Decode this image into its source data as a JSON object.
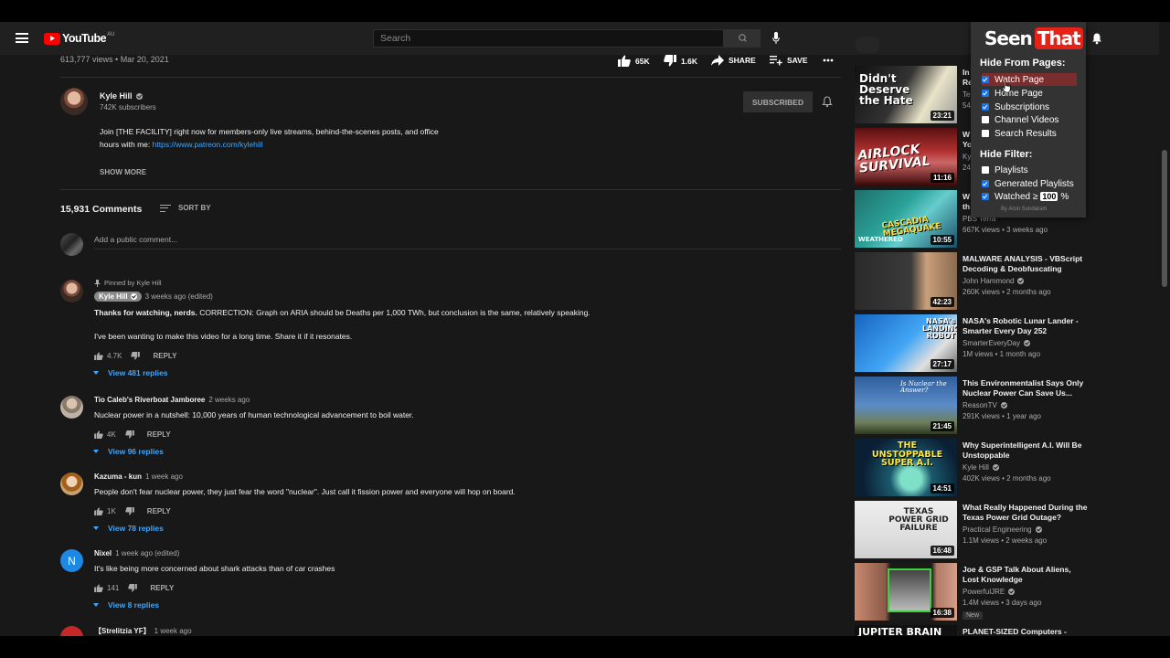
{
  "masthead": {
    "logo_text": "YouTube",
    "logo_region": "AU",
    "search_placeholder": "Search"
  },
  "video": {
    "views_date": "613,777 views • Mar 20, 2021",
    "likes": "65K",
    "dislikes": "1.6K",
    "share_label": "SHARE",
    "save_label": "SAVE"
  },
  "channel": {
    "name": "Kyle Hill",
    "subscribers": "742K subscribers",
    "subscribed_label": "SUBSCRIBED"
  },
  "description": {
    "line1": "Join [THE FACILITY] right now for members-only live streams, behind-the-scenes posts, and office",
    "line2_prefix": "hours with me: ",
    "link": "https://www.patreon.com/kylehill",
    "show_more": "SHOW MORE"
  },
  "comments": {
    "count_label": "15,931 Comments",
    "sort_label": "SORT BY",
    "add_placeholder": "Add a public comment...",
    "items": [
      {
        "pinned": "Pinned by Kyle Hill",
        "author": "Kyle Hill",
        "time": "3 weeks ago (edited)",
        "text_bold": "Thanks for watching, nerds.",
        "text": " CORRECTION: Graph on ARIA should be Deaths per 1,000 TWh, but conclusion is the same, relatively speaking.",
        "text2": "I've been wanting to make this video for a long time. Share it if it resonates.",
        "likes": "4.7K",
        "reply": "REPLY",
        "replies": "View 481 replies"
      },
      {
        "author": "Tio Caleb's Riverboat Jamboree",
        "time": "2 weeks ago",
        "text": "Nuclear power in a nutshell: 10,000 years of human technological advancement to boil water.",
        "likes": "4K",
        "reply": "REPLY",
        "replies": "View 96 replies"
      },
      {
        "author": "Kazuma - kun",
        "time": "1 week ago",
        "text": "People don't fear nuclear power, they just fear the word \"nuclear\". Just call it fission power and everyone will hop on board.",
        "likes": "1K",
        "reply": "REPLY",
        "replies": "View 78 replies"
      },
      {
        "author": "Nixel",
        "avatar_letter": "N",
        "time": "1 week ago (edited)",
        "text": "It's like being more concerned about shark attacks than of car crashes",
        "likes": "141",
        "reply": "REPLY",
        "replies": "View 8 replies"
      },
      {
        "author": "【Strelitzia YF】",
        "time": "1 week ago"
      }
    ]
  },
  "recommendations": [
    {
      "title": "In",
      "title2": "Re",
      "channel": "Te",
      "meta": "54",
      "duration": "23:21",
      "thumb_text": "Didn't Deserve the Hate"
    },
    {
      "title": "W",
      "title2": "Yo",
      "channel": "Ky",
      "meta": "24",
      "duration": "11:16",
      "thumb_text": "AIRLOCK SURVIVAL"
    },
    {
      "title": "W",
      "title2": "th",
      "channel": "PBS Terra",
      "meta": "667K views • 3 weeks ago",
      "duration": "10:55",
      "thumb_text": "CASCADIA MEGAQUAKE",
      "thumb_text2": "WEATHERED"
    },
    {
      "title": "MALWARE ANALYSIS - VBScript Decoding & Deobfuscating",
      "channel": "John Hammond",
      "meta": "260K views • 2 months ago",
      "duration": "42:23"
    },
    {
      "title": "NASA's Robotic Lunar Lander - Smarter Every Day 252",
      "channel": "SmarterEveryDay",
      "meta": "1M views • 1 month ago",
      "duration": "27:17",
      "thumb_text": "NASA's LANDING ROBOT"
    },
    {
      "title": "This Environmentalist Says Only Nuclear Power Can Save Us...",
      "channel": "ReasonTV",
      "meta": "291K views • 1 year ago",
      "duration": "21:45",
      "thumb_text": "Is Nuclear the Answer?"
    },
    {
      "title": "Why Superintelligent A.I. Will Be Unstoppable",
      "channel": "Kyle Hill",
      "meta": "402K views • 2 months ago",
      "duration": "14:51",
      "thumb_text": "THE UNSTOPPABLE SUPER A.I."
    },
    {
      "title": "What Really Happened During the Texas Power Grid Outage?",
      "channel": "Practical Engineering",
      "meta": "1.1M views • 2 weeks ago",
      "duration": "16:48",
      "thumb_text": "TEXAS POWER GRID FAILURE"
    },
    {
      "title": "Joe & GSP Talk About Aliens, Lost Knowledge",
      "channel": "PowerfulJRE",
      "meta": "1.4M views • 3 days ago",
      "duration": "16:38",
      "badge": "New"
    },
    {
      "title": "PLANET-SIZED Computers -",
      "thumb_text": "JUPITER BRAIN"
    }
  ],
  "extension": {
    "logo_seen": "Seen",
    "logo_that": "That",
    "hide_pages_heading": "Hide From Pages:",
    "pages": [
      {
        "label": "Watch Page",
        "checked": true
      },
      {
        "label": "Home Page",
        "checked": true
      },
      {
        "label": "Subscriptions",
        "checked": true
      },
      {
        "label": "Channel Videos",
        "checked": false
      },
      {
        "label": "Search Results",
        "checked": false
      }
    ],
    "hide_filter_heading": "Hide Filter:",
    "filters": [
      {
        "label": "Playlists",
        "checked": false
      },
      {
        "label": "Generated Playlists",
        "checked": true
      }
    ],
    "watched_label": "Watched ≥",
    "watched_value": "100",
    "watched_unit": "%",
    "byline": "By Arun Sundaram"
  },
  "colors": {
    "background": "#181818",
    "masthead": "#202020",
    "link": "#3ea6ff",
    "brand_red": "#ff0000",
    "checkbox": "#1a73e8"
  }
}
